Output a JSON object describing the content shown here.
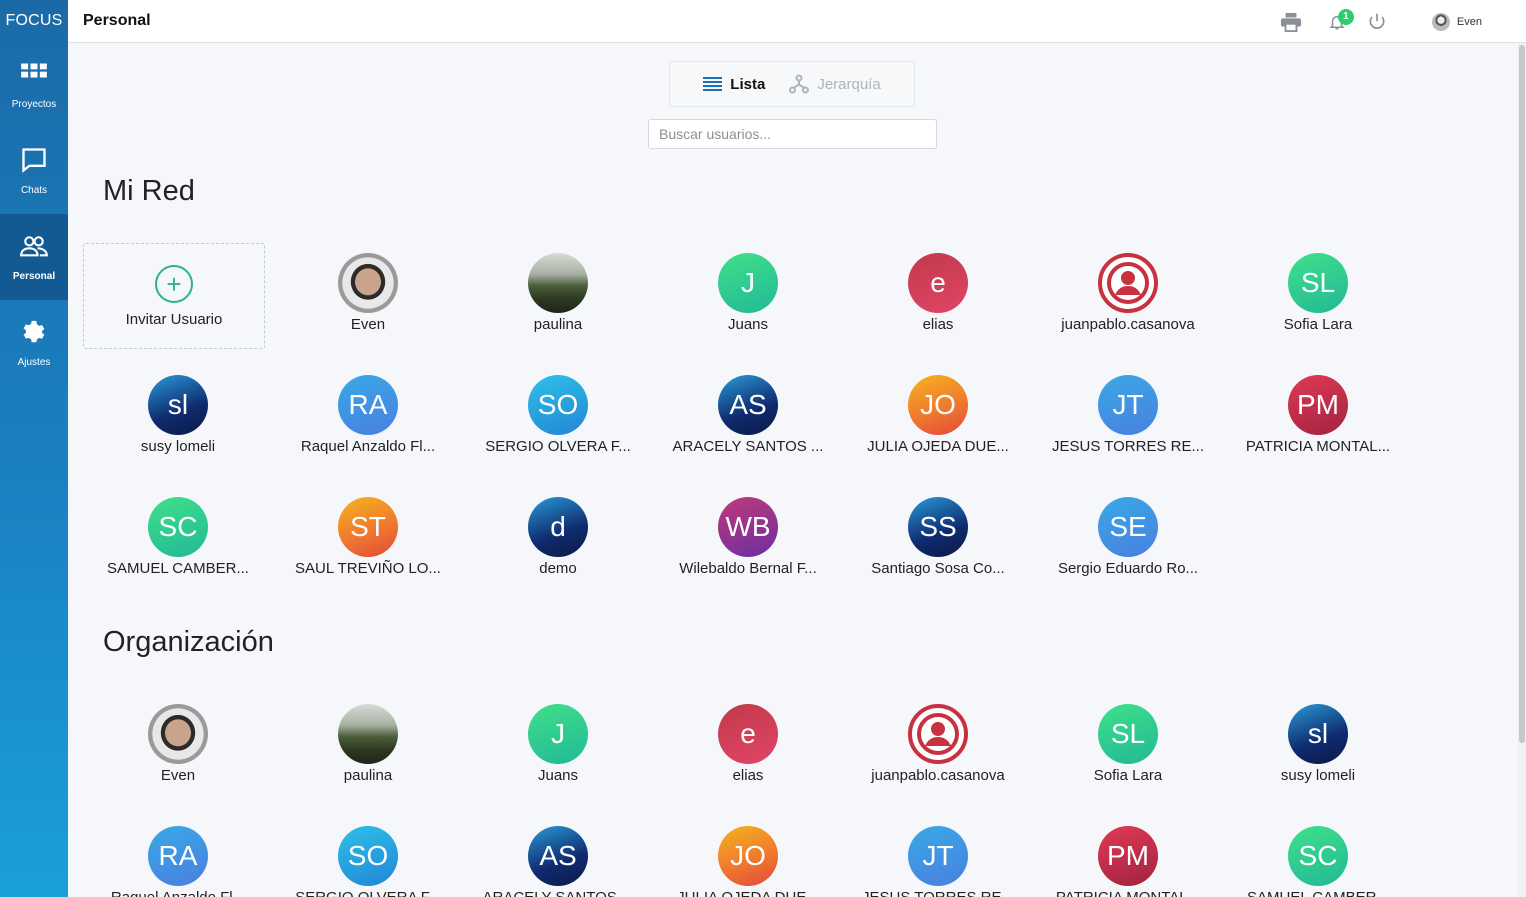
{
  "app": {
    "brand": "FOCUS",
    "page_title": "Personal"
  },
  "sidebar": {
    "items": [
      {
        "label": "Proyectos",
        "icon": "grid-icon",
        "active": false
      },
      {
        "label": "Chats",
        "icon": "chat-icon",
        "active": false
      },
      {
        "label": "Personal",
        "icon": "people-icon",
        "active": true
      },
      {
        "label": "Ajustes",
        "icon": "gear-icon",
        "active": false
      }
    ]
  },
  "topbar": {
    "notification_count": "1",
    "user_name": "Even"
  },
  "view_toggle": {
    "list_label": "Lista",
    "hierarchy_label": "Jerarquía",
    "active": "Lista"
  },
  "search": {
    "placeholder": "Buscar usuarios..."
  },
  "colors": {
    "sidebar_top": "#1b6aa8",
    "sidebar_bottom": "#1aa0d8",
    "accent_green": "#2bb48a",
    "badge": "#2ecc71"
  },
  "mi_red": {
    "title": "Mi Red",
    "invite_label": "Invitar Usuario",
    "users": [
      {
        "name": "Even",
        "avatar": "photo",
        "style": "photo-even",
        "initials": ""
      },
      {
        "name": "paulina",
        "avatar": "photo",
        "style": "photo-paulina",
        "initials": ""
      },
      {
        "name": "Juans",
        "avatar": "initials",
        "style": "g-green",
        "initials": "J"
      },
      {
        "name": "elias",
        "avatar": "initials",
        "style": "g-red",
        "initials": "e"
      },
      {
        "name": "juanpablo.casanova",
        "avatar": "profile-icon",
        "style": "profile-ring",
        "initials": ""
      },
      {
        "name": "Sofia Lara",
        "avatar": "initials",
        "style": "g-green",
        "initials": "SL"
      },
      {
        "name": "susy lomeli",
        "avatar": "initials",
        "style": "g-navy",
        "initials": "sl"
      },
      {
        "name": "Raquel Anzaldo Fl...",
        "avatar": "initials",
        "style": "g-blue2",
        "initials": "RA"
      },
      {
        "name": "SERGIO OLVERA F...",
        "avatar": "initials",
        "style": "g-blue",
        "initials": "SO"
      },
      {
        "name": "ARACELY SANTOS ...",
        "avatar": "initials",
        "style": "g-navy",
        "initials": "AS"
      },
      {
        "name": "JULIA OJEDA DUE...",
        "avatar": "initials",
        "style": "g-orange",
        "initials": "JO"
      },
      {
        "name": "JESUS TORRES RE...",
        "avatar": "initials",
        "style": "g-blue2",
        "initials": "JT"
      },
      {
        "name": "PATRICIA MONTAL...",
        "avatar": "initials",
        "style": "g-maroon",
        "initials": "PM"
      },
      {
        "name": "SAMUEL CAMBER...",
        "avatar": "initials",
        "style": "g-green",
        "initials": "SC"
      },
      {
        "name": "SAUL TREVIÑO LO...",
        "avatar": "initials",
        "style": "g-orange",
        "initials": "ST"
      },
      {
        "name": "demo",
        "avatar": "initials",
        "style": "g-navy",
        "initials": "d"
      },
      {
        "name": "Wilebaldo Bernal F...",
        "avatar": "initials",
        "style": "g-purple",
        "initials": "WB"
      },
      {
        "name": "Santiago Sosa Co...",
        "avatar": "initials",
        "style": "g-navy",
        "initials": "SS"
      },
      {
        "name": "Sergio Eduardo Ro...",
        "avatar": "initials",
        "style": "g-blue2",
        "initials": "SE"
      }
    ]
  },
  "organizacion": {
    "title": "Organización",
    "users": [
      {
        "name": "Even",
        "avatar": "photo",
        "style": "photo-even",
        "initials": ""
      },
      {
        "name": "paulina",
        "avatar": "photo",
        "style": "photo-paulina",
        "initials": ""
      },
      {
        "name": "Juans",
        "avatar": "initials",
        "style": "g-green",
        "initials": "J"
      },
      {
        "name": "elias",
        "avatar": "initials",
        "style": "g-red",
        "initials": "e"
      },
      {
        "name": "juanpablo.casanova",
        "avatar": "profile-icon",
        "style": "profile-ring",
        "initials": ""
      },
      {
        "name": "Sofia Lara",
        "avatar": "initials",
        "style": "g-green",
        "initials": "SL"
      },
      {
        "name": "susy lomeli",
        "avatar": "initials",
        "style": "g-navy",
        "initials": "sl"
      },
      {
        "name": "Raquel Anzaldo Fl...",
        "avatar": "initials",
        "style": "g-blue2",
        "initials": "RA"
      },
      {
        "name": "SERGIO OLVERA F...",
        "avatar": "initials",
        "style": "g-blue",
        "initials": "SO"
      },
      {
        "name": "ARACELY SANTOS ...",
        "avatar": "initials",
        "style": "g-navy",
        "initials": "AS"
      },
      {
        "name": "JULIA OJEDA DUE...",
        "avatar": "initials",
        "style": "g-orange",
        "initials": "JO"
      },
      {
        "name": "JESUS TORRES RE...",
        "avatar": "initials",
        "style": "g-blue2",
        "initials": "JT"
      },
      {
        "name": "PATRICIA MONTAL...",
        "avatar": "initials",
        "style": "g-maroon",
        "initials": "PM"
      },
      {
        "name": "SAMUEL CAMBER...",
        "avatar": "initials",
        "style": "g-green",
        "initials": "SC"
      }
    ]
  }
}
